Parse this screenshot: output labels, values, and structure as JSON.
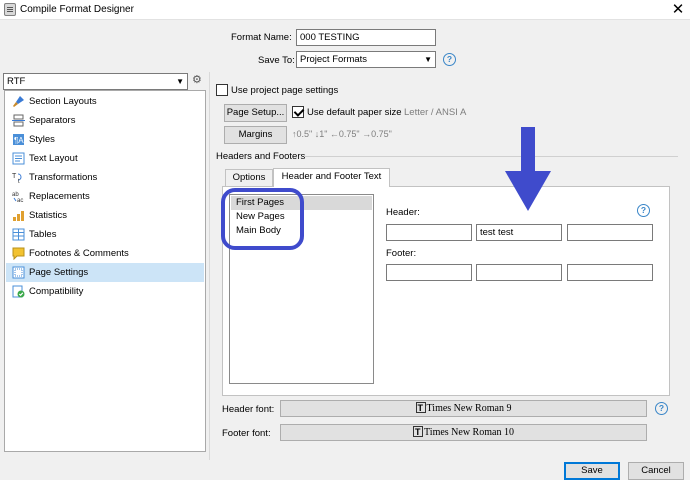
{
  "window": {
    "title": "Compile Format Designer",
    "close_glyph": "✕"
  },
  "format": {
    "name_label": "Format Name:",
    "name_value": "000 TESTING",
    "save_label": "Save To:",
    "save_value": "Project Formats"
  },
  "compile_for": {
    "value": "RTF"
  },
  "sidebar": {
    "items": [
      {
        "label": "Section Layouts",
        "icon": "brush-icon"
      },
      {
        "label": "Separators",
        "icon": "separator-icon"
      },
      {
        "label": "Styles",
        "icon": "styles-icon"
      },
      {
        "label": "Text Layout",
        "icon": "text-layout-icon"
      },
      {
        "label": "Transformations",
        "icon": "transformations-icon"
      },
      {
        "label": "Replacements",
        "icon": "replacements-icon"
      },
      {
        "label": "Statistics",
        "icon": "statistics-icon"
      },
      {
        "label": "Tables",
        "icon": "tables-icon"
      },
      {
        "label": "Footnotes & Comments",
        "icon": "footnotes-icon"
      },
      {
        "label": "Page Settings",
        "icon": "page-settings-icon"
      },
      {
        "label": "Compatibility",
        "icon": "compatibility-icon"
      }
    ],
    "selected_index": 9
  },
  "page_settings": {
    "use_project_label": "Use project page settings",
    "page_setup_label": "Page Setup...",
    "use_default_paper_label": "Use default paper size",
    "paper_size": "Letter / ANSI A",
    "margins_label": "Margins",
    "margins_value": "↑0.5\" ↓1\" ←0.75\" →0.75\"",
    "headers_footers_title": "Headers and Footers"
  },
  "tabs": [
    {
      "label": "Options"
    },
    {
      "label": "Header and Footer Text"
    }
  ],
  "active_tab": 1,
  "page_types": {
    "items": [
      "First Pages",
      "New Pages",
      "Main Body"
    ],
    "selected_index": 0
  },
  "header": {
    "label": "Header:",
    "left": "",
    "center": "test   test",
    "right": ""
  },
  "footer": {
    "label": "Footer:",
    "left": "",
    "center": "",
    "right": ""
  },
  "fonts": {
    "header_label": "Header font:",
    "header_value": "Times New Roman 9",
    "footer_label": "Footer font:",
    "footer_value": "Times New Roman 10"
  },
  "buttons": {
    "save": "Save",
    "cancel": "Cancel"
  },
  "colors": {
    "accent": "#0078d7",
    "selection": "#cce4f7",
    "annotation": "#3f4bcc"
  }
}
